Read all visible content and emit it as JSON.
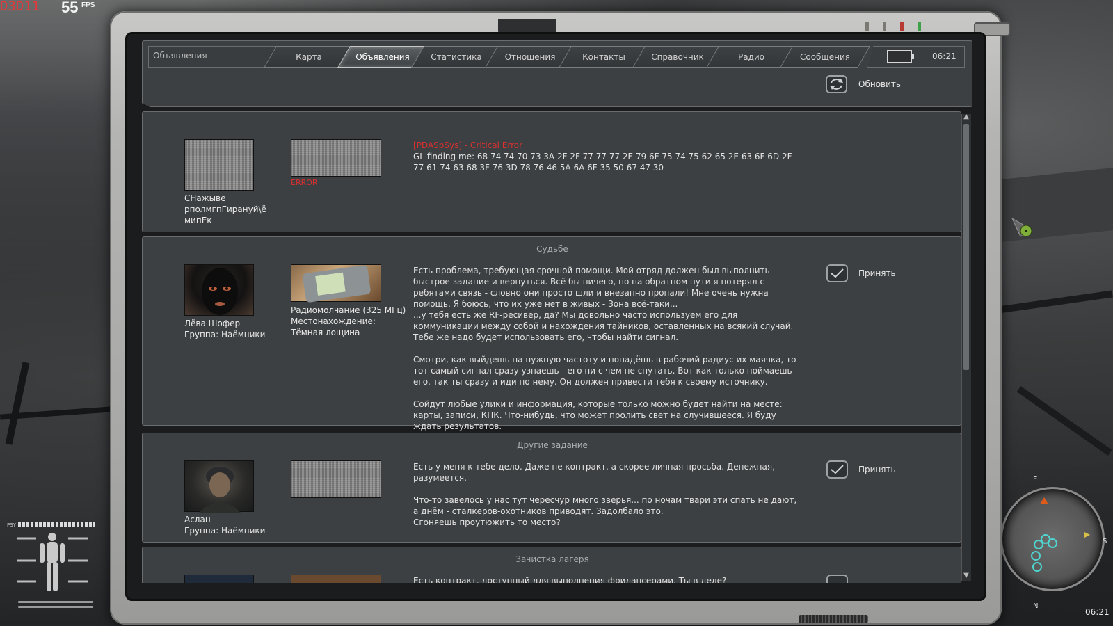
{
  "hud": {
    "renderer": "D3D11",
    "fps": "55",
    "fps_unit": "FPS",
    "psy_label": "PSY",
    "minimap_east": "E",
    "minimap_south": "S",
    "minimap_north": "N",
    "game_time": "06:21"
  },
  "pda": {
    "section_title": "Объявления",
    "clock": "06:21",
    "tabs": [
      {
        "label": "Карта",
        "active": false
      },
      {
        "label": "Объявления",
        "active": true
      },
      {
        "label": "Статистика",
        "active": false
      },
      {
        "label": "Отношения",
        "active": false
      },
      {
        "label": "Контакты",
        "active": false
      },
      {
        "label": "Справочник",
        "active": false
      },
      {
        "label": "Радио",
        "active": false
      },
      {
        "label": "Сообщения",
        "active": false
      }
    ],
    "refresh_label": "Обновить"
  },
  "tasks": [
    {
      "title": "",
      "sender_name": "СНажыве рполмгпГирануй\\ё мипЕк",
      "sender_group": "",
      "item_caption": "ERROR",
      "item_info": "",
      "error_title": "[PDASpSys] - Critical Error",
      "message": "GL finding me: 68 74 74 70 73 3A 2F 2F 77 77 77 2E 79 6F 75 74 75 62 65 2E 63 6F 6D 2F 77 61 74 63 68 3F 76 3D 78 76 46 5A 6A 6F 35 50 67 47 30",
      "accept_label": ""
    },
    {
      "title": "Судьбе",
      "sender_name": "Лёва Шофер",
      "sender_group": "Группа: Наёмники",
      "item_caption": "",
      "item_info": "Радиомолчание (325 МГц)\nМестонахождение:\nТёмная лощина",
      "error_title": "",
      "message": "Есть проблема, требующая срочной помощи. Мой отряд должен был выполнить быстрое задание и вернуться. Всё бы ничего, но на обратном пути я потерял с ребятами связь - словно они просто шли и внезапно пропали! Мне очень нужна помощь. Я боюсь, что их уже нет в живых - Зона всё-таки...\n...у тебя есть же RF-ресивер, да? Мы довольно часто используем его для коммуникации между собой и нахождения тайников, оставленных на всякий случай. Тебе же надо будет использовать его, чтобы найти сигнал.\n\nСмотри, как выйдешь на нужную частоту и попадёшь в рабочий радиус их маячка, то тот самый сигнал сразу узнаешь - его ни с чем не спутать. Вот как только поймаешь его, так ты сразу и иди по нему. Он должен привести тебя к своему источнику.\n\nСойдут любые улики и информация, которые только можно будет найти на месте: карты, записи, КПК. Что-нибудь, что может пролить свет на случившееся. Я буду ждать результатов.",
      "accept_label": "Принять"
    },
    {
      "title": "Другие задание",
      "sender_name": "Аслан",
      "sender_group": "Группа: Наёмники",
      "item_caption": "",
      "item_info": "",
      "error_title": "",
      "message": "Есть у меня к тебе дело. Даже не контракт, а скорее личная просьба. Денежная, разумеется.\n\nЧто-то завелось у нас тут чересчур много зверья... по ночам твари эти спать не дают, а днём - сталкеров-охотников приводят. Задолбало это.\nСгоняешь проутюжить то место?",
      "accept_label": "Принять"
    },
    {
      "title": "Зачистка лагеря",
      "sender_name": "",
      "sender_group": "",
      "item_caption": "",
      "item_info": "",
      "error_title": "",
      "message": "Есть контракт, доступный для выполнения фрилансерами. Ты в деле?",
      "accept_label": ""
    }
  ],
  "colors": {
    "panel": "#3d4042",
    "panel_border": "#6a6d6f",
    "error_red": "#d83030",
    "pda_body": "#b4b4b2"
  }
}
